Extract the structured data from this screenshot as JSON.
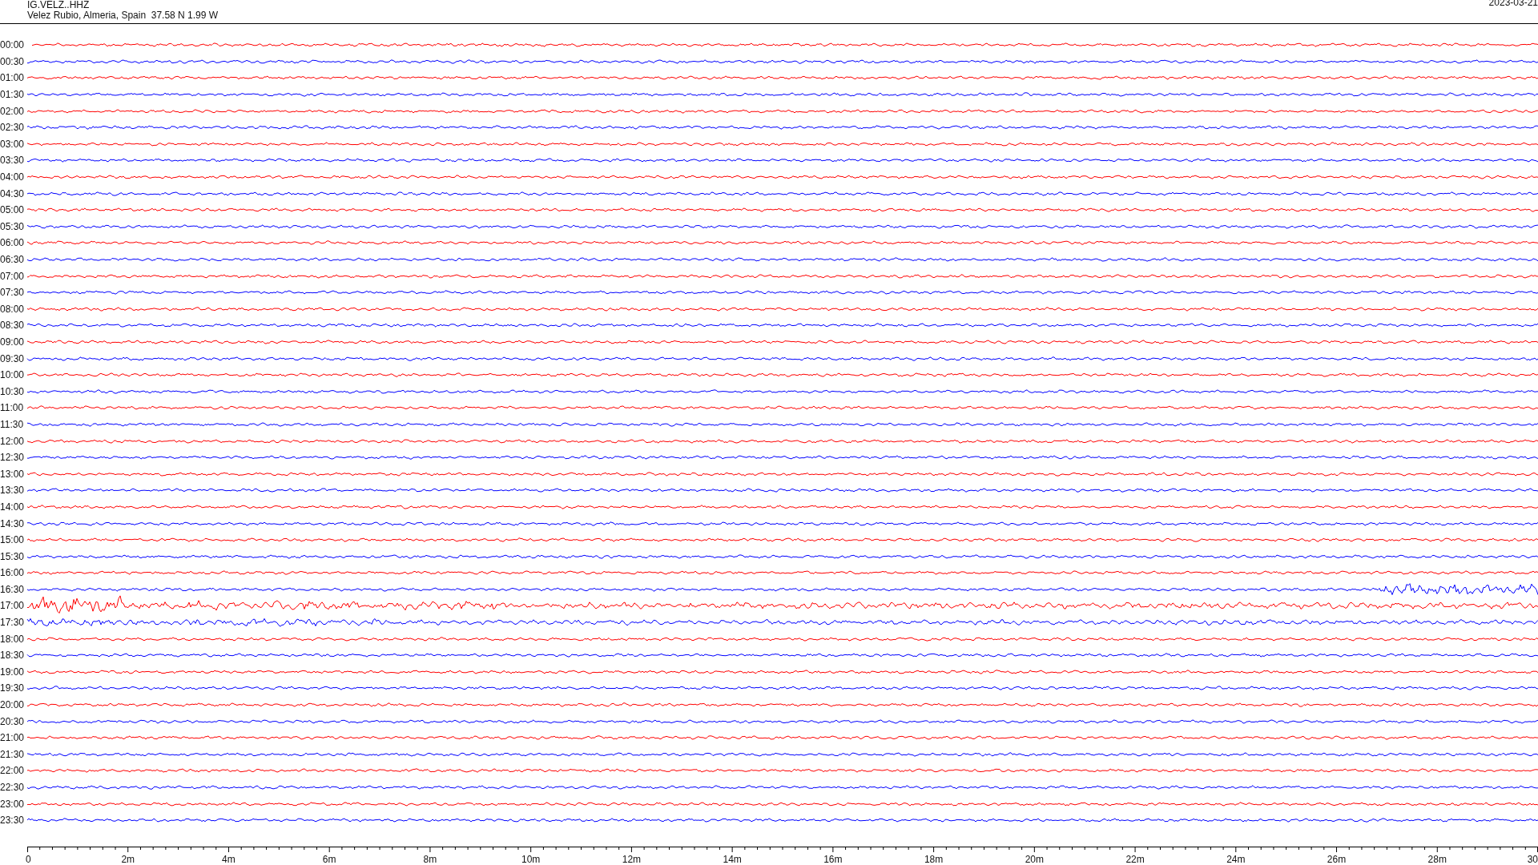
{
  "header": {
    "station": "IG.VELZ..HHZ",
    "location": "Velez Rubio, Almeria, Spain  37.58 N 1.99 W",
    "date": "2023-03-21"
  },
  "rows": [
    {
      "label": "00:00",
      "color": "#ff0000"
    },
    {
      "label": "00:30",
      "color": "#0000ff"
    },
    {
      "label": "01:00",
      "color": "#ff0000"
    },
    {
      "label": "01:30",
      "color": "#0000ff"
    },
    {
      "label": "02:00",
      "color": "#ff0000"
    },
    {
      "label": "02:30",
      "color": "#0000ff"
    },
    {
      "label": "03:00",
      "color": "#ff0000"
    },
    {
      "label": "03:30",
      "color": "#0000ff"
    },
    {
      "label": "04:00",
      "color": "#ff0000"
    },
    {
      "label": "04:30",
      "color": "#0000ff"
    },
    {
      "label": "05:00",
      "color": "#ff0000"
    },
    {
      "label": "05:30",
      "color": "#0000ff"
    },
    {
      "label": "06:00",
      "color": "#ff0000"
    },
    {
      "label": "06:30",
      "color": "#0000ff"
    },
    {
      "label": "07:00",
      "color": "#ff0000"
    },
    {
      "label": "07:30",
      "color": "#0000ff"
    },
    {
      "label": "08:00",
      "color": "#ff0000"
    },
    {
      "label": "08:30",
      "color": "#0000ff"
    },
    {
      "label": "09:00",
      "color": "#ff0000"
    },
    {
      "label": "09:30",
      "color": "#0000ff"
    },
    {
      "label": "10:00",
      "color": "#ff0000"
    },
    {
      "label": "10:30",
      "color": "#0000ff"
    },
    {
      "label": "11:00",
      "color": "#ff0000"
    },
    {
      "label": "11:30",
      "color": "#0000ff"
    },
    {
      "label": "12:00",
      "color": "#ff0000"
    },
    {
      "label": "12:30",
      "color": "#0000ff"
    },
    {
      "label": "13:00",
      "color": "#ff0000"
    },
    {
      "label": "13:30",
      "color": "#0000ff"
    },
    {
      "label": "14:00",
      "color": "#ff0000"
    },
    {
      "label": "14:30",
      "color": "#0000ff"
    },
    {
      "label": "15:00",
      "color": "#ff0000"
    },
    {
      "label": "15:30",
      "color": "#0000ff"
    },
    {
      "label": "16:00",
      "color": "#ff0000"
    },
    {
      "label": "16:30",
      "color": "#0000ff"
    },
    {
      "label": "17:00",
      "color": "#ff0000"
    },
    {
      "label": "17:30",
      "color": "#0000ff"
    },
    {
      "label": "18:00",
      "color": "#ff0000"
    },
    {
      "label": "18:30",
      "color": "#0000ff"
    },
    {
      "label": "19:00",
      "color": "#ff0000"
    },
    {
      "label": "19:30",
      "color": "#0000ff"
    },
    {
      "label": "20:00",
      "color": "#ff0000"
    },
    {
      "label": "20:30",
      "color": "#0000ff"
    },
    {
      "label": "21:00",
      "color": "#ff0000"
    },
    {
      "label": "21:30",
      "color": "#0000ff"
    },
    {
      "label": "22:00",
      "color": "#ff0000"
    },
    {
      "label": "22:30",
      "color": "#0000ff"
    },
    {
      "label": "23:00",
      "color": "#ff0000"
    },
    {
      "label": "23:30",
      "color": "#0000ff"
    }
  ],
  "axis": {
    "labels": [
      "0",
      "2m",
      "4m",
      "6m",
      "8m",
      "10m",
      "12m",
      "14m",
      "16m",
      "18m",
      "20m",
      "22m",
      "24m",
      "26m",
      "28m",
      "30"
    ]
  }
}
